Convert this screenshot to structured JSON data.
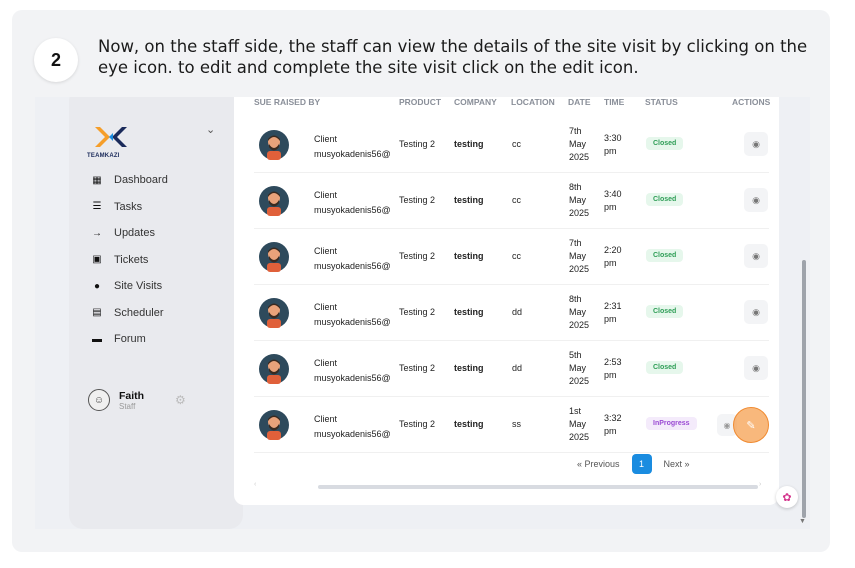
{
  "step": {
    "number": "2",
    "instruction": "Now, on the staff side, the staff can view the details of the site visit by clicking on the eye icon. to edit and complete the site visit click on the edit icon."
  },
  "brand": {
    "logo_text": "TEAMKAZI"
  },
  "sidebar": {
    "items": [
      {
        "label": "Dashboard",
        "icon": "dashboard-icon"
      },
      {
        "label": "Tasks",
        "icon": "tasks-icon"
      },
      {
        "label": "Updates",
        "icon": "updates-icon"
      },
      {
        "label": "Tickets",
        "icon": "ticket-icon"
      },
      {
        "label": "Site Visits",
        "icon": "location-pin-icon"
      },
      {
        "label": "Scheduler",
        "icon": "calendar-icon"
      },
      {
        "label": "Forum",
        "icon": "chat-icon"
      }
    ],
    "user": {
      "name": "Faith",
      "role": "Staff"
    }
  },
  "table": {
    "headers": {
      "raised_by": "SUE RAISED BY",
      "product": "PRODUCT",
      "company": "COMPANY",
      "location": "LOCATION",
      "date": "DATE",
      "time": "TIME",
      "status": "STATUS",
      "actions": "ACTIONS"
    },
    "rows": [
      {
        "client_label": "Client",
        "client_email": "musyokadenis56@",
        "product": "Testing 2",
        "company": "testing",
        "location": "cc",
        "date_day": "7th",
        "date_month": "May",
        "date_year": "2025",
        "time_hm": "3:30",
        "time_ampm": "pm",
        "status": "Closed"
      },
      {
        "client_label": "Client",
        "client_email": "musyokadenis56@",
        "product": "Testing 2",
        "company": "testing",
        "location": "cc",
        "date_day": "8th",
        "date_month": "May",
        "date_year": "2025",
        "time_hm": "3:40",
        "time_ampm": "pm",
        "status": "Closed"
      },
      {
        "client_label": "Client",
        "client_email": "musyokadenis56@",
        "product": "Testing 2",
        "company": "testing",
        "location": "cc",
        "date_day": "7th",
        "date_month": "May",
        "date_year": "2025",
        "time_hm": "2:20",
        "time_ampm": "pm",
        "status": "Closed"
      },
      {
        "client_label": "Client",
        "client_email": "musyokadenis56@",
        "product": "Testing 2",
        "company": "testing",
        "location": "dd",
        "date_day": "8th",
        "date_month": "May",
        "date_year": "2025",
        "time_hm": "2:31",
        "time_ampm": "pm",
        "status": "Closed"
      },
      {
        "client_label": "Client",
        "client_email": "musyokadenis56@",
        "product": "Testing 2",
        "company": "testing",
        "location": "dd",
        "date_day": "5th",
        "date_month": "May",
        "date_year": "2025",
        "time_hm": "2:53",
        "time_ampm": "pm",
        "status": "Closed"
      },
      {
        "client_label": "Client",
        "client_email": "musyokadenis56@",
        "product": "Testing 2",
        "company": "testing",
        "location": "ss",
        "date_day": "1st",
        "date_month": "May",
        "date_year": "2025",
        "time_hm": "3:32",
        "time_ampm": "pm",
        "status": "InProgress"
      }
    ]
  },
  "pagination": {
    "previous": "« Previous",
    "current": "1",
    "next": "Next »"
  },
  "colors": {
    "accent": "#1a8ce0",
    "closed": "#2f9e57",
    "inprogress": "#9a4ad3",
    "highlight": "#f08a30"
  }
}
